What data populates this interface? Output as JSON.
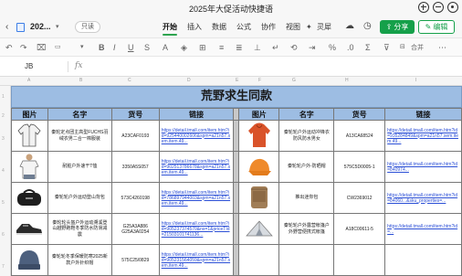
{
  "window": {
    "title": "2025年大促活动快捷语"
  },
  "menubar": {
    "filename": "202...",
    "open_label": "只读",
    "tabs": [
      "开始",
      "插入",
      "数据",
      "公式",
      "协作",
      "视图"
    ],
    "active_tab": "开始",
    "ling_label": "灵犀",
    "share_label": "分享",
    "edit_label": "编辑"
  },
  "toolbar": {
    "merge_label": "合并"
  },
  "formula": {
    "cell_ref": "JB",
    "fx_label": "fx"
  },
  "colors": {
    "header_blue": "#9dbde3",
    "accent_green": "#15a04a",
    "link_blue": "#2b4fd6"
  },
  "sheet": {
    "banner_title": "荒野求生同款",
    "headers": {
      "picture": "图片",
      "name": "名字",
      "code": "货号",
      "link": "链接"
    },
    "left_rows": [
      {
        "name": "秦轮定点团主高型FUCHS羽绒衣男二合一棉服装",
        "code": "A23CAF0193",
        "link": "https://detail.tmall.com/item.htm?id=925440002606&spm=a21n57.sem.item.49...",
        "icon": "jacket-icon"
      },
      {
        "name": "耐脏户外速干T恤",
        "code": "3350A5S057",
        "link": "https://detail.tmall.com/item.htm?id=902513786678&spm=a21n57.sem.item.49...",
        "icon": "tshirt-icon"
      },
      {
        "name": "秦轮轮户外运动登山背包",
        "code": "573C4260198",
        "link": "https://detail.tmall.com/item.htm?id=786897944003&spm=a21n57.sem.item.49...",
        "icon": "bag-icon"
      },
      {
        "name": "秦轮轮头盔户外运动溯溪登山越野跑鞋冬季防水防滑减震",
        "code": "G25A3A886 G25A3A0254",
        "link": "https://detail.tmall.com/item.htm?id=905237374570&ns=1&priceTId=21503101741136...",
        "icon": "shoe-icon"
      },
      {
        "name": "秦轮轮冬季保暖防寒2025新款户外针织帽",
        "code": "575C25/0829",
        "link": "https://detail.tmall.com/item.htm?id=905231564059&spm=a21n57.sem.item.49...",
        "icon": "beanie-icon"
      }
    ],
    "right_rows": [
      {
        "name": "秦轮轮户外运动冲锋衣防风防水男女",
        "code": "A13CA68524",
        "link": "https://detail.tmall.com/item.htm?id=935284849&spm=a21n57.sem.item.49...",
        "icon": "hoodie-icon"
      },
      {
        "name": "秦轮轮户外-防晒帽",
        "code": "575C5D0005-1",
        "link": "https://detail.tmall.com/item.htm?id=840974...",
        "icon": "cap-icon"
      },
      {
        "name": "推出迷你包",
        "code": "CW2369012",
        "link": "https://detail.tmall.com/item.htm?id=84060...&sku_properties=...",
        "icon": "pouch-icon"
      },
      {
        "name": "秦轮轮户外露营帐篷户外野营便携式帐篷",
        "code": "A18C00611-5",
        "link": "https://detail.tmall.com/item.htm?id=...",
        "icon": "tent-icon"
      },
      {
        "name": "",
        "code": "",
        "link": "",
        "icon": ""
      }
    ]
  }
}
